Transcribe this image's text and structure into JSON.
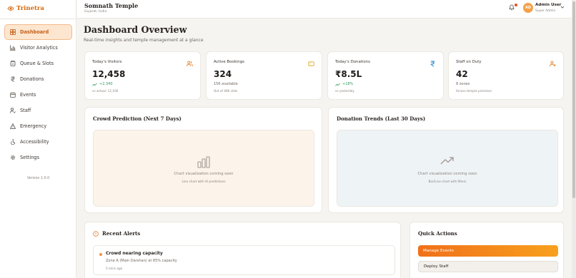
{
  "app": {
    "name": "Trinetra",
    "version": "Version 1.0.0"
  },
  "sidebar": {
    "items": [
      {
        "label": "Dashboard",
        "icon": "dashboard-icon",
        "active": true
      },
      {
        "label": "Visitor Analytics",
        "icon": "bar-chart-icon"
      },
      {
        "label": "Queue & Slots",
        "icon": "clipboard-icon"
      },
      {
        "label": "Donations",
        "icon": "rupee-icon"
      },
      {
        "label": "Events",
        "icon": "calendar-icon"
      },
      {
        "label": "Staff",
        "icon": "user-check-icon"
      },
      {
        "label": "Emergency",
        "icon": "warning-icon"
      },
      {
        "label": "Accessibility",
        "icon": "accessibility-icon"
      },
      {
        "label": "Settings",
        "icon": "gear-icon"
      }
    ]
  },
  "header": {
    "temple_name": "Somnath Temple",
    "location": "Gujarat, India",
    "user": {
      "initials": "AD",
      "name": "Admin User",
      "role": "Super Admin"
    }
  },
  "main": {
    "title": "Dashboard Overview",
    "subtitle": "Real-time insights and temple management at a glance",
    "stats": [
      {
        "label": "Today's Visitors",
        "value": "12,458",
        "change": "+2,340",
        "trend": "up",
        "note": "vs actual: 12,100",
        "icon": "users-icon"
      },
      {
        "label": "Active Bookings",
        "value": "324",
        "change": "156 available",
        "trend": "neutral",
        "note": "Out of 480 slots",
        "icon": "ticket-icon"
      },
      {
        "label": "Today's Donations",
        "value": "₹8.5L",
        "change": "+18%",
        "trend": "up",
        "note": "vs yesterday",
        "icon": "rupee-icon"
      },
      {
        "label": "Staff on Duty",
        "value": "42",
        "change": "8 zones",
        "trend": "neutral",
        "note": "Across temple premises",
        "icon": "user-add-icon"
      }
    ],
    "crowd_prediction": {
      "title": "Crowd Prediction (Next 7 Days)",
      "placeholder": "Chart visualization coming soon",
      "placeholder_sub": "Line chart with AI predictions"
    },
    "donation_trends": {
      "title": "Donation Trends (Last 30 Days)",
      "placeholder": "Chart visualization coming soon",
      "placeholder_sub": "Bar/Line chart with filters"
    },
    "alerts": {
      "title": "Recent Alerts",
      "items": [
        {
          "name": "Crowd nearing capacity",
          "desc": "Zone A (Main Darshan) at 85% capacity",
          "time": "5 mins ago"
        }
      ]
    },
    "quick_actions": {
      "title": "Quick Actions",
      "buttons": [
        {
          "label": "Manage Events"
        },
        {
          "label": "Deploy Staff"
        }
      ]
    }
  },
  "colors": {
    "accent": "#f0701a",
    "sidebar_active_bg": "#fde6cf",
    "positive": "#2f9d5c"
  }
}
